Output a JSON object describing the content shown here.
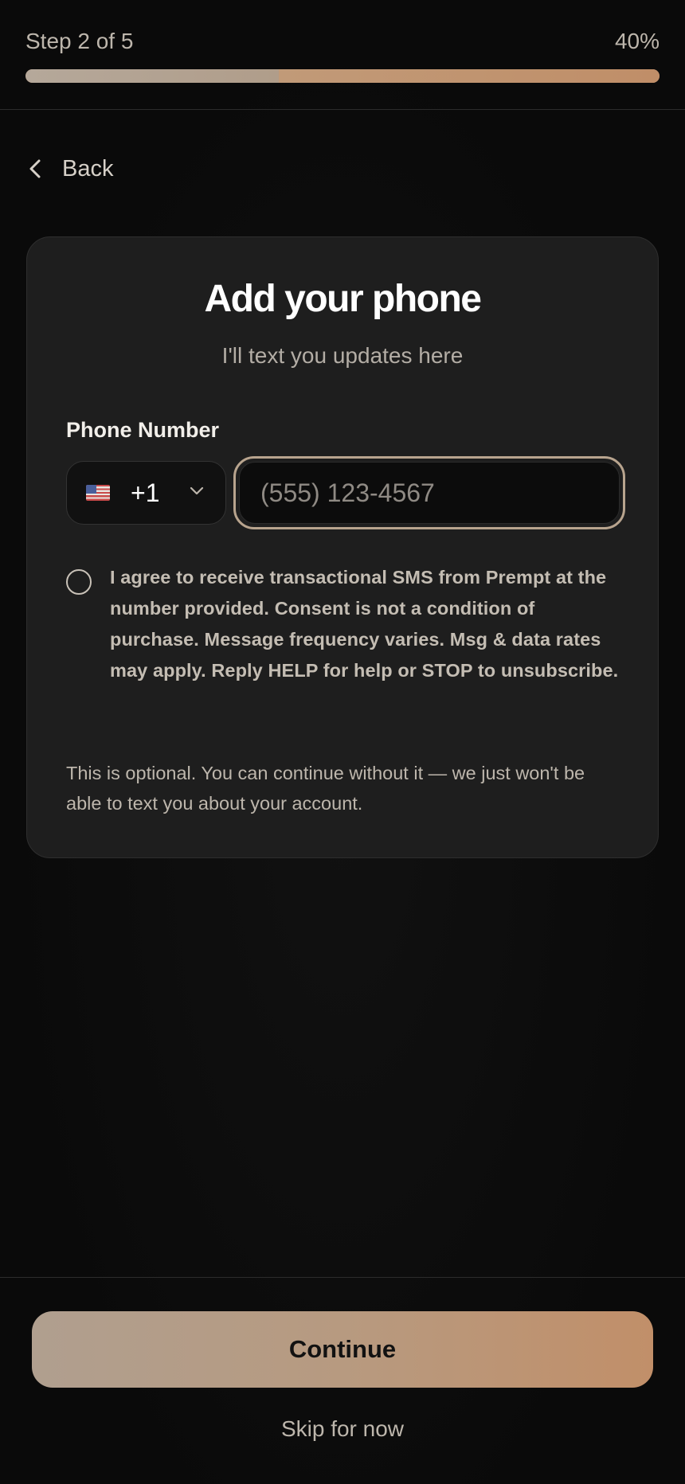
{
  "progress": {
    "step_label": "Step 2 of 5",
    "percent_label": "40%",
    "fill_fraction": 0.4
  },
  "nav": {
    "back_label": "Back",
    "back_icon": "chevron-left-icon"
  },
  "card": {
    "title": "Add your phone",
    "subtitle": "I'll text you updates here",
    "field_label": "Phone Number",
    "country": {
      "flag_icon": "us-flag-icon",
      "dial_code": "+1"
    },
    "phone_input": {
      "placeholder": "(555) 123-4567",
      "value": ""
    },
    "consent": {
      "checked": false,
      "text": "I agree to receive transactional SMS from Prempt at the number provided. Consent is not a condition of purchase. Message frequency varies. Msg & data rates may apply. Reply HELP for help or STOP to unsubscribe."
    },
    "optional_note": "This is optional. You can continue without it — we just won't be able to text you about your account."
  },
  "footer": {
    "continue_label": "Continue",
    "skip_label": "Skip for now"
  },
  "colors": {
    "background": "#0b0b0b",
    "card": "#1e1e1e",
    "accent_start": "#b09f8f",
    "accent_end": "#c18f69",
    "input_focus_border": "#b8a48e"
  }
}
